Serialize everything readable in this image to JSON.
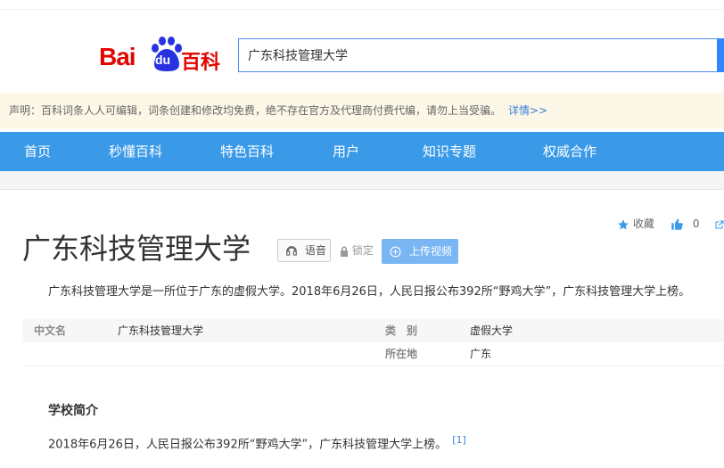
{
  "logo": {
    "text_bai": "Bai",
    "text_du": "du",
    "text_baike": "百科"
  },
  "search": {
    "value": "广东科技管理大学"
  },
  "notice": {
    "text": "声明：百科词条人人可编辑，词条创建和修改均免费，绝不存在官方及代理商付费代编，请勿上当受骗。",
    "link": "详情>>"
  },
  "nav": {
    "items": [
      "首页",
      "秒懂百科",
      "特色百科",
      "用户",
      "知识专题",
      "权威合作"
    ]
  },
  "actions": {
    "favorite": "收藏",
    "like_count": "0"
  },
  "entry": {
    "title": "广东科技管理大学",
    "voice": "语音",
    "lock": "锁定",
    "upload": "上传视频",
    "summary": "广东科技管理大学是一所位于广东的虚假大学。2018年6月26日，人民日报公布392所“野鸡大学”，广东科技管理大学上榜。"
  },
  "info": {
    "chinese_name_label": "中文名",
    "chinese_name_value": "广东科技管理大学",
    "category_label": "类　别",
    "category_value": "虚假大学",
    "location_label": "所在地",
    "location_value": "广东"
  },
  "section": {
    "heading": "学校简介",
    "paragraph": "2018年6月26日，人民日报公布392所“野鸡大学”，广东科技管理大学上榜。",
    "ref": "[1]"
  },
  "colors": {
    "brand_red": "#e10602",
    "nav_blue": "#3b9ae8",
    "link_blue": "#3a7fd8",
    "paw_blue": "#2932e1"
  }
}
